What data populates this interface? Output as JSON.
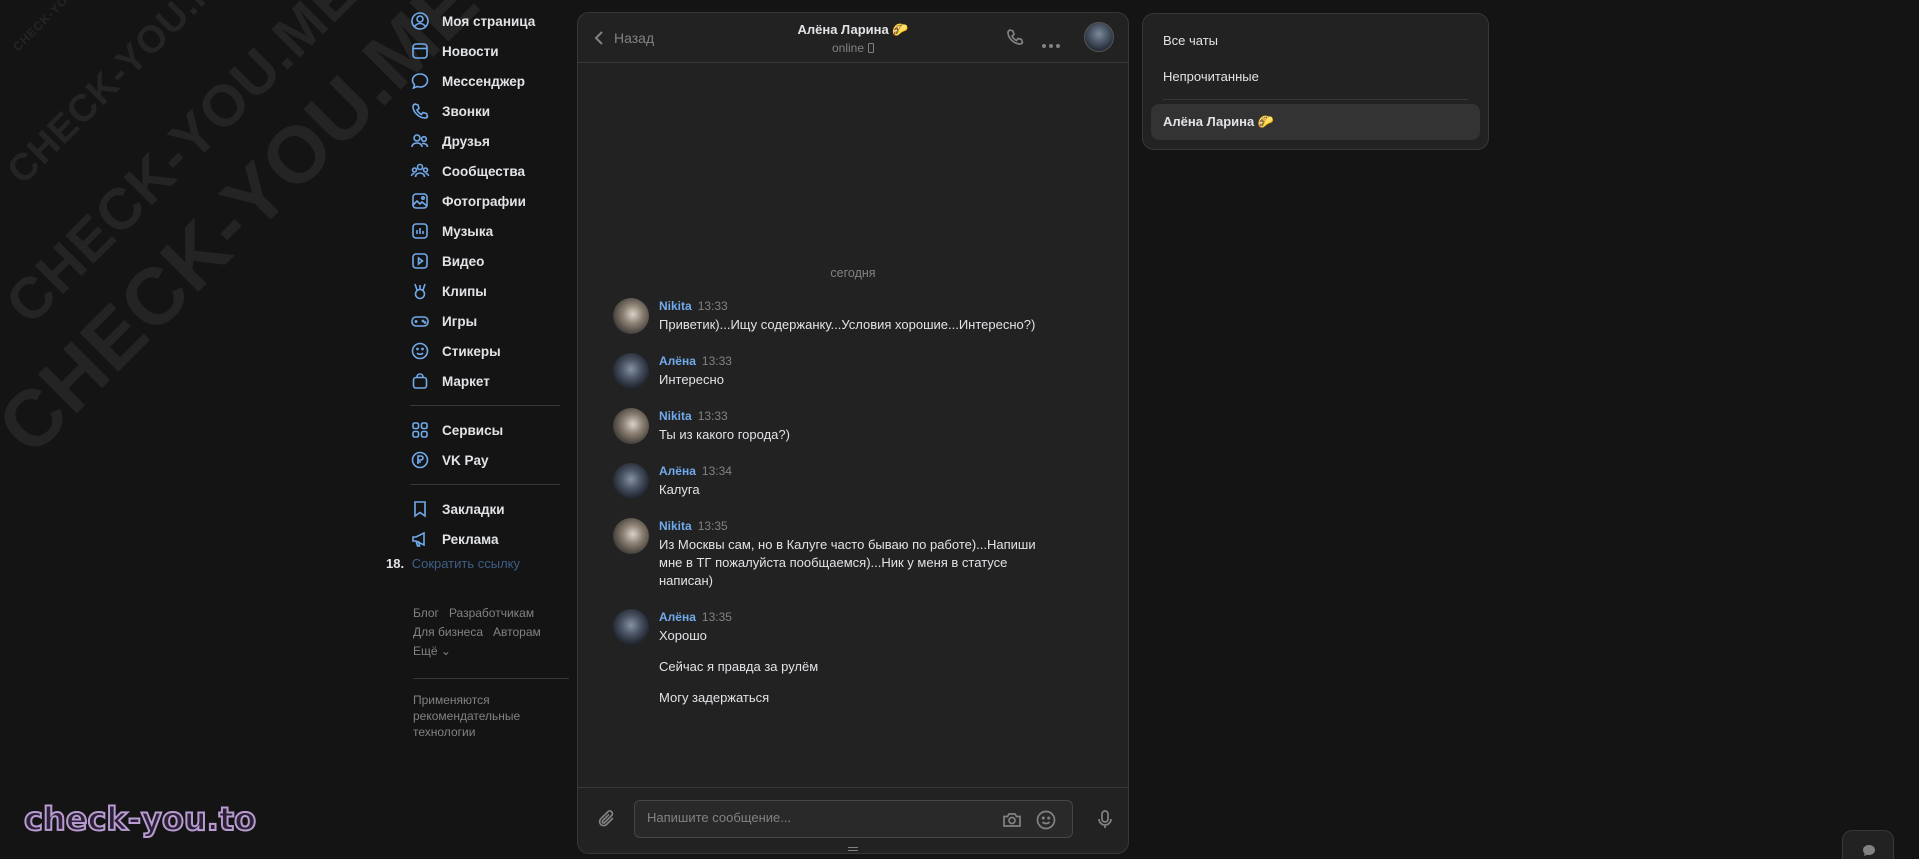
{
  "watermarks": {
    "small": "CHECK-YOU.ME",
    "medium": "CHECK-YOU.ME",
    "large": "CHECK-YOU.ME",
    "xlarge": "CHECK-YOU.ME",
    "brand": "check-you.to"
  },
  "nav": {
    "items": [
      {
        "label": "Моя страница",
        "icon": "user-circle-icon"
      },
      {
        "label": "Новости",
        "icon": "news-icon"
      },
      {
        "label": "Мессенджер",
        "icon": "message-icon"
      },
      {
        "label": "Звонки",
        "icon": "phone-icon"
      },
      {
        "label": "Друзья",
        "icon": "friends-icon"
      },
      {
        "label": "Сообщества",
        "icon": "communities-icon"
      },
      {
        "label": "Фотографии",
        "icon": "photo-icon"
      },
      {
        "label": "Музыка",
        "icon": "music-icon"
      },
      {
        "label": "Видео",
        "icon": "video-icon"
      },
      {
        "label": "Клипы",
        "icon": "clips-icon"
      },
      {
        "label": "Игры",
        "icon": "gamepad-icon"
      },
      {
        "label": "Стикеры",
        "icon": "smile-icon"
      },
      {
        "label": "Маркет",
        "icon": "bag-icon"
      }
    ],
    "group2": [
      {
        "label": "Сервисы",
        "icon": "grid-icon"
      },
      {
        "label": "VK Pay",
        "icon": "pay-icon"
      }
    ],
    "group3": [
      {
        "label": "Закладки",
        "icon": "bookmark-icon"
      },
      {
        "label": "Реклама",
        "icon": "megaphone-icon"
      }
    ],
    "short_link_num": "18.",
    "short_link": "Сократить ссылку"
  },
  "footer": {
    "blog": "Блог",
    "devs": "Разработчикам",
    "business": "Для бизнеса",
    "authors": "Авторам",
    "more": "Ещё ⌄",
    "note": "Применяются рекомендательные технологии"
  },
  "chat": {
    "back_label": "Назад",
    "peer_name": "Алёна Ларина 🌮",
    "peer_status": "online",
    "date_separator": "сегодня",
    "messages": [
      {
        "author": "Nikita",
        "time": "13:33",
        "text": "Приветик)...Ищу содержанку...Условия хорошие...Интересно?)",
        "avatar": "nikita"
      },
      {
        "author": "Алёна",
        "time": "13:33",
        "text": "Интересно",
        "avatar": "alena"
      },
      {
        "author": "Nikita",
        "time": "13:33",
        "text": "Ты из какого города?)",
        "avatar": "nikita"
      },
      {
        "author": "Алёна",
        "time": "13:34",
        "text": "Калуга",
        "avatar": "alena"
      },
      {
        "author": "Nikita",
        "time": "13:35",
        "text": "Из Москвы сам, но в Калуге часто бываю по работе)...Напиши мне в ТГ пожалуйста пообщаемся)...Ник у меня в статусе написан)",
        "avatar": "nikita"
      },
      {
        "author": "Алёна",
        "time": "13:35",
        "text": "Хорошо",
        "avatar": "alena",
        "extra": [
          "Сейчас я правда за рулём",
          "Могу задержаться"
        ]
      }
    ],
    "composer_placeholder": "Напишите сообщение..."
  },
  "folders": {
    "all": "Все чаты",
    "unread": "Непрочитанные",
    "active": "Алёна Ларина 🌮"
  },
  "colors": {
    "accent": "#71aaeb",
    "background": "#141414",
    "panel": "#222222"
  }
}
